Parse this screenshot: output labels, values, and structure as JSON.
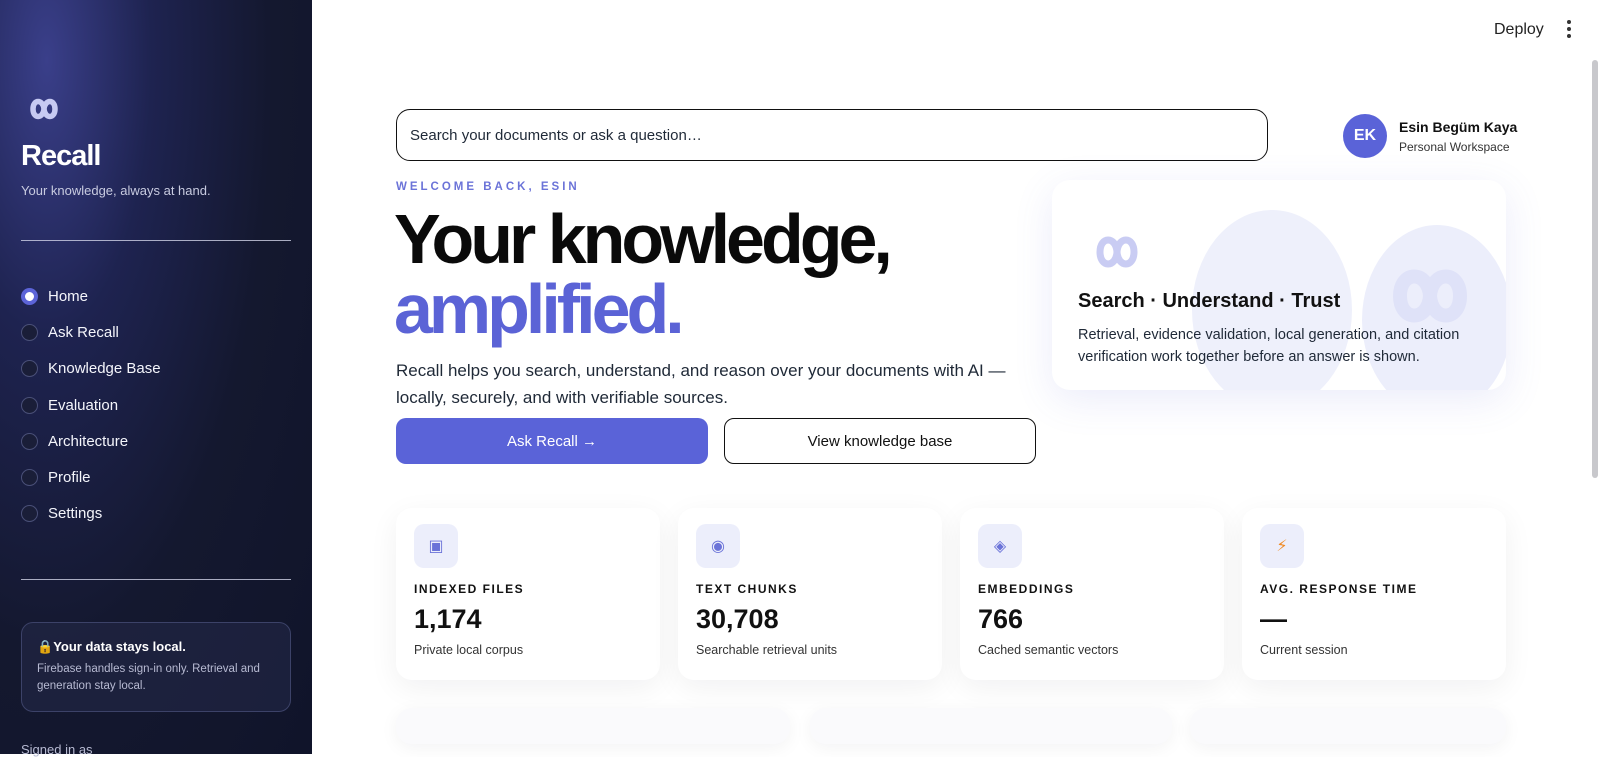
{
  "sidebar": {
    "brand": "Recall",
    "tagline": "Your knowledge, always at hand.",
    "nav": [
      {
        "label": "Home",
        "selected": true
      },
      {
        "label": "Ask Recall",
        "selected": false
      },
      {
        "label": "Knowledge Base",
        "selected": false
      },
      {
        "label": "Evaluation",
        "selected": false
      },
      {
        "label": "Architecture",
        "selected": false
      },
      {
        "label": "Profile",
        "selected": false
      },
      {
        "label": "Settings",
        "selected": false
      }
    ],
    "local_title": "Your data stays local.",
    "local_text": "Firebase handles sign-in only. Retrieval and generation stay local.",
    "signed_in": "Signed in as"
  },
  "toolbar": {
    "deploy_label": "Deploy"
  },
  "search": {
    "placeholder": "Search your documents or ask a question…"
  },
  "user": {
    "initials": "EK",
    "name": "Esin Begüm Kaya",
    "workspace": "Personal Workspace"
  },
  "hero": {
    "welcome": "WELCOME BACK, ESIN",
    "line1": "Your knowledge,",
    "line2": "amplified.",
    "description": "Recall helps you search, understand, and reason over your documents with AI — locally, securely, and with verifiable sources.",
    "primary_button": "Ask Recall →",
    "secondary_button": "View knowledge base"
  },
  "feature": {
    "title": "Search · Understand · Trust",
    "text": "Retrieval, evidence validation, local generation, and citation verification work together before an answer is shown."
  },
  "stats": [
    {
      "icon": "document-icon",
      "glyph": "▣",
      "label": "INDEXED FILES",
      "value": "1,174",
      "sub": "Private local corpus"
    },
    {
      "icon": "chunk-icon",
      "glyph": "◉",
      "label": "TEXT CHUNKS",
      "value": "30,708",
      "sub": "Searchable retrieval units"
    },
    {
      "icon": "embedding-icon",
      "glyph": "◈",
      "label": "EMBEDDINGS",
      "value": "766",
      "sub": "Cached semantic vectors"
    },
    {
      "icon": "lightning-icon",
      "glyph": "⚡",
      "label": "AVG. RESPONSE TIME",
      "value": "—",
      "sub": "Current session"
    }
  ],
  "colors": {
    "accent": "#5a63d8",
    "sidebar_bg": "#14182f"
  }
}
